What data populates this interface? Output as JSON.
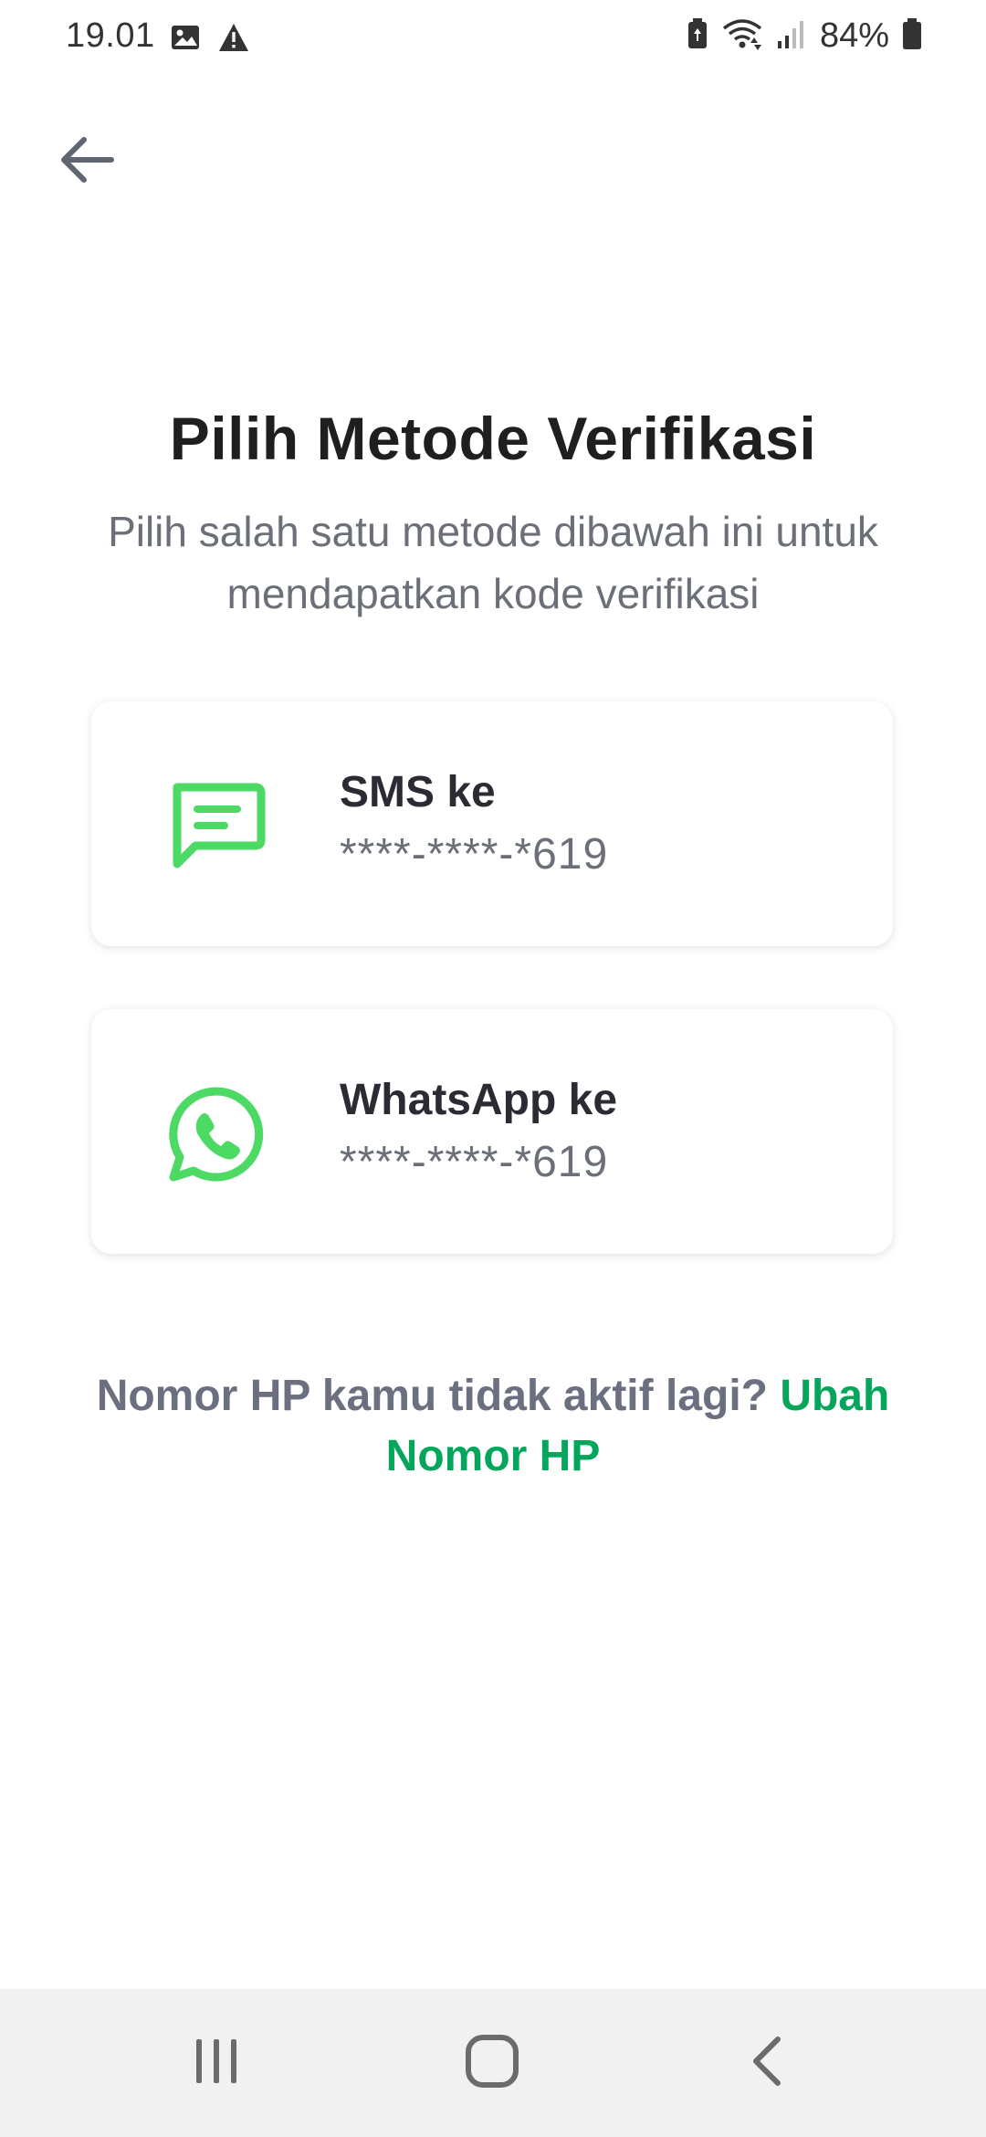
{
  "status_bar": {
    "time": "19.01",
    "battery_percent": "84%",
    "left_icons": [
      "image-icon",
      "alert-icon"
    ],
    "right_icons": [
      "battery-saver-icon",
      "wifi-icon",
      "signal-icon",
      "battery-icon"
    ]
  },
  "header": {
    "back_icon": "arrow-left-icon"
  },
  "main": {
    "title": "Pilih Metode Verifikasi",
    "subtitle": "Pilih salah satu metode dibawah ini untuk mendapatkan kode verifikasi",
    "options": [
      {
        "icon": "chat-message-icon",
        "title": "SMS ke",
        "number": "****-****-*619"
      },
      {
        "icon": "whatsapp-icon",
        "title": "WhatsApp ke",
        "number": "****-****-*619"
      }
    ],
    "change_number_prompt": "Nomor HP kamu tidak aktif lagi?",
    "change_number_link": "Ubah Nomor HP"
  },
  "nav_bar": {
    "icons": [
      "recents-icon",
      "home-icon",
      "back-icon"
    ]
  },
  "colors": {
    "accent_green": "#03a65a",
    "icon_green": "#4cd964",
    "title_text": "#1f1f1f",
    "muted_text": "#6b6f78"
  }
}
